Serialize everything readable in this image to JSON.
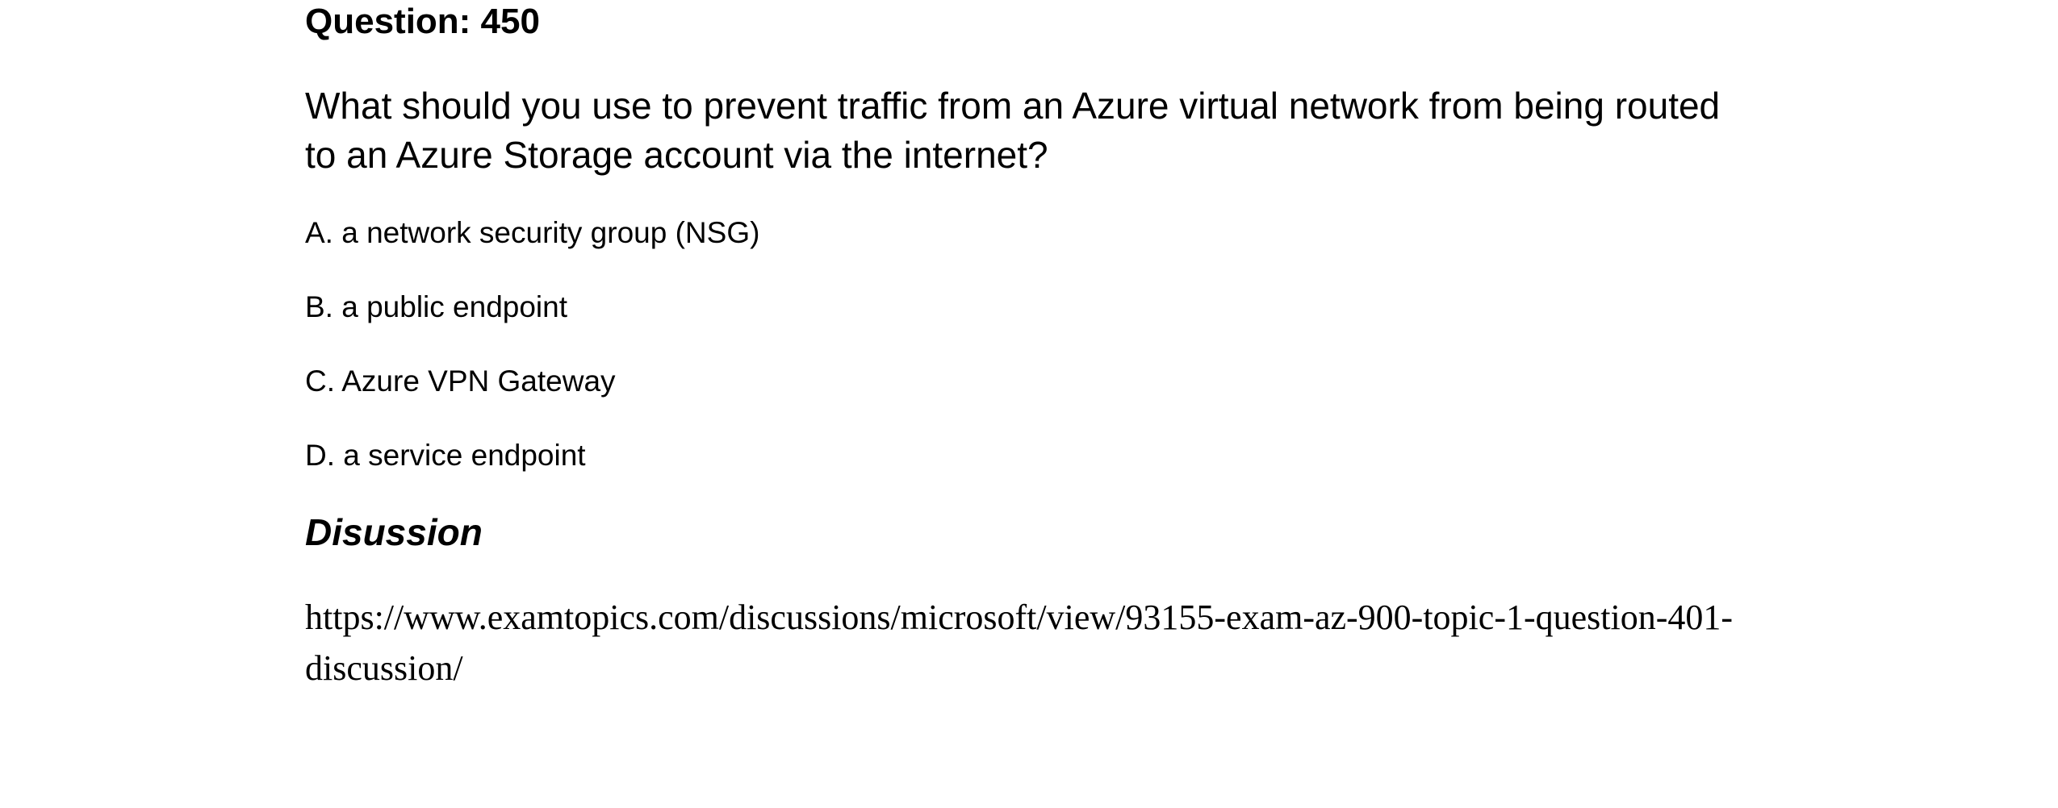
{
  "question": {
    "heading": "Question: 450",
    "text": "What should you use to prevent traffic from an Azure virtual network from being routed to an Azure Storage account via the internet?",
    "options": [
      {
        "label": "A. a network security group (NSG)"
      },
      {
        "label": "B. a public endpoint"
      },
      {
        "label": "C. Azure VPN Gateway"
      },
      {
        "label": "D. a service endpoint"
      }
    ]
  },
  "discussion": {
    "heading": "Disussion",
    "url": "https://www.examtopics.com/discussions/microsoft/view/93155-exam-az-900-topic-1-question-401-discussion/"
  }
}
